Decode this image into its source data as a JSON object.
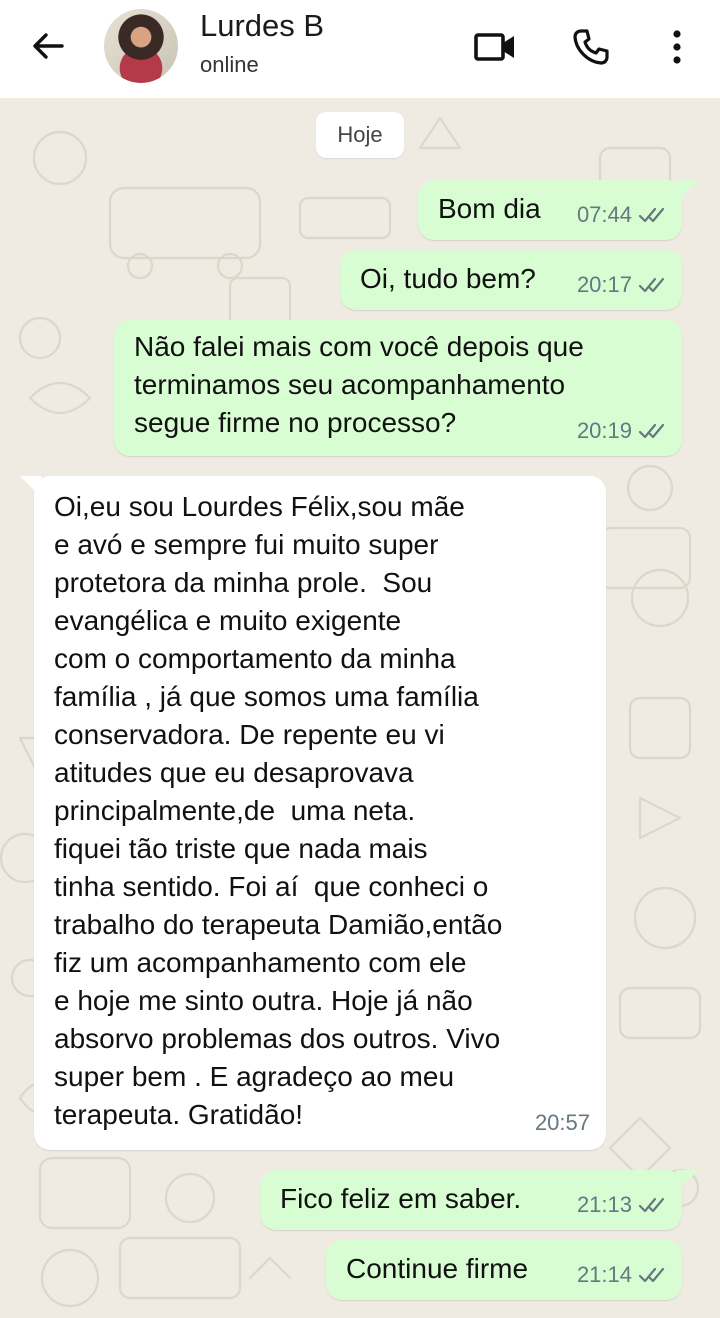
{
  "header": {
    "contact_name": "Lurdes B",
    "status": "online"
  },
  "chat": {
    "date_chip": "Hoje",
    "messages": [
      {
        "direction": "out",
        "text": "Bom dia",
        "time": "07:44",
        "read": true
      },
      {
        "direction": "out",
        "text": "Oi, tudo bem?",
        "time": "20:17",
        "read": true
      },
      {
        "direction": "out",
        "text": "Não falei mais com você depois que\nterminamos seu acompanhamento\nsegue firme no processo?",
        "time": "20:19",
        "read": true
      },
      {
        "direction": "in",
        "text": "Oi,eu sou Lourdes Félix,sou mãe\ne avó e sempre fui muito super\nprotetora da minha prole.  Sou\nevangélica e muito exigente\ncom o comportamento da minha\nfamília , já que somos uma família\nconservadora. De repente eu vi\natitudes que eu desaprovava\nprincipalmente,de  uma neta.\nfiquei tão triste que nada mais\ntinha sentido. Foi aí  que conheci o\ntrabalho do terapeuta Damião,então\nfiz um acompanhamento com ele\ne hoje me sinto outra. Hoje já não\nabsorvo problemas dos outros. Vivo\nsuper bem . E agradeço ao meu\nterapeuta. Gratidão!",
        "time": "20:57",
        "read": false
      },
      {
        "direction": "out",
        "text": "Fico feliz em saber.",
        "time": "21:13",
        "read": true
      },
      {
        "direction": "out",
        "text": "Continue firme",
        "time": "21:14",
        "read": true
      }
    ]
  },
  "icons": {
    "back": "arrow-left-icon",
    "video": "video-camera-icon",
    "call": "phone-icon",
    "menu": "more-vertical-icon",
    "read_receipt": "double-check-icon"
  },
  "colors": {
    "outgoing_bubble": "#d9fdd3",
    "incoming_bubble": "#ffffff",
    "chat_background": "#efeae2",
    "tick_color": "#667781"
  }
}
